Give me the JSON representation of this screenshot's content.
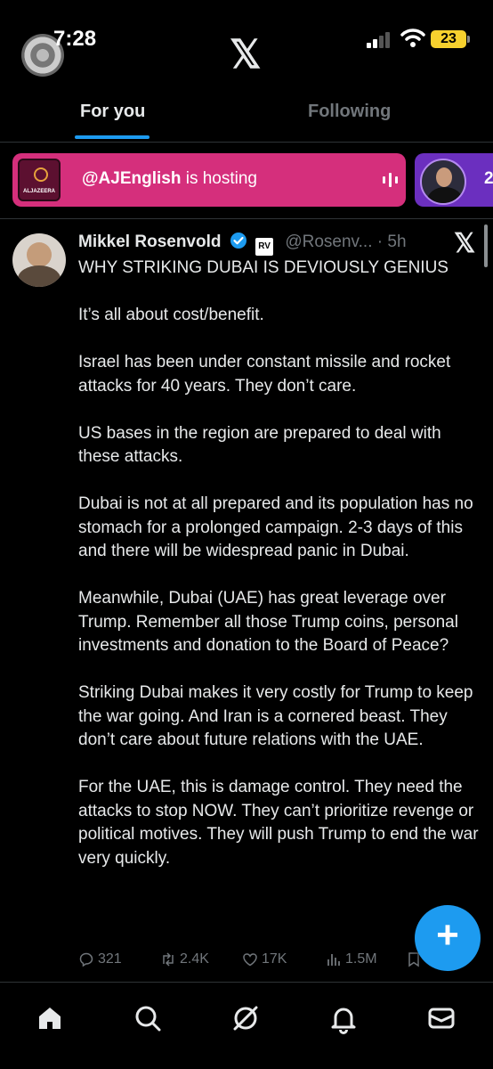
{
  "status_bar": {
    "time": "7:28",
    "battery": "23"
  },
  "header": {
    "logo": "𝕏"
  },
  "tabs": [
    {
      "label": "For you",
      "active": true
    },
    {
      "label": "Following",
      "active": false
    }
  ],
  "spaces": {
    "host_handle": "@AJEnglish",
    "host_suffix": " is hosting",
    "logo_text": "ALJAZEERA",
    "second_count": "2"
  },
  "tweet": {
    "author_name": "Mikkel Rosenvold",
    "affiliate_badge": "RV",
    "handle": "@Rosenv...",
    "dot": "·",
    "time": "5h",
    "x_mark": "𝕏",
    "body": [
      "WHY STRIKING DUBAI IS DEVIOUSLY GENIUS",
      "It’s all about cost/benefit.",
      "Israel has been under constant missile and rocket attacks for 40 years. They don’t care.",
      "US bases in the region are prepared to deal with these attacks.",
      "Dubai is not at all prepared and its population has no stomach for a prolonged campaign. 2-3 days of this and there will be widespread panic in Dubai.",
      "Meanwhile, Dubai (UAE) has great leverage over Trump. Remember all those Trump coins, personal investments and donation to the Board of Peace?",
      "Striking Dubai makes it very costly for Trump to keep the war going. And Iran is a cornered beast. They don’t care about future relations with the UAE.",
      "For the UAE, this is damage control. They need the attacks to stop NOW. They can’t prioritize revenge or political motives. They will push Trump to end the war very quickly."
    ],
    "actions": {
      "replies": "321",
      "reposts": "2.4K",
      "likes": "17K",
      "views": "1.5M"
    }
  },
  "fab": {
    "label": "+"
  },
  "bottom_nav": [
    "home-icon",
    "search-icon",
    "grok-icon",
    "notifications-icon",
    "messages-icon"
  ],
  "colors": {
    "accent": "#1d9bf0",
    "spaces_card": "#d52f7c",
    "spaces_card_2": "#6b2fbf",
    "battery": "#f7d12e"
  }
}
